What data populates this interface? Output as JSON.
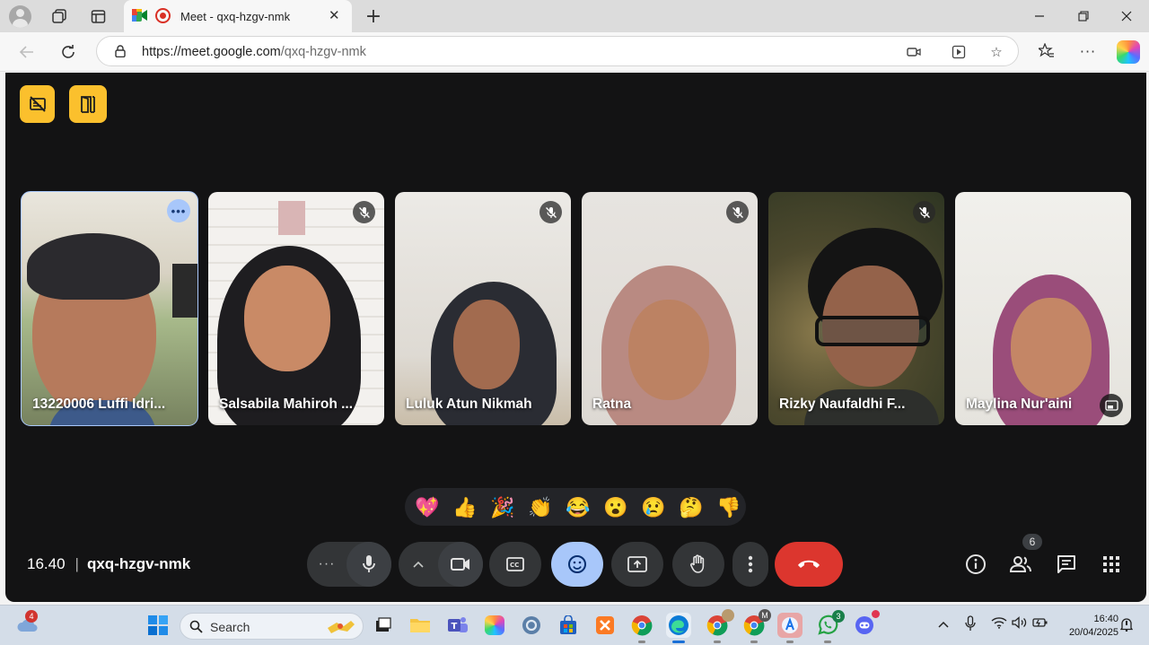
{
  "browser": {
    "tab_title": "Meet - qxq-hzgv-nmk",
    "url_host": "https://meet.google.com",
    "url_path": "/qxq-hzgv-nmk"
  },
  "meeting": {
    "time": "16.40",
    "separator": "|",
    "code": "qxq-hzgv-nmk",
    "participant_count": "6"
  },
  "participants": [
    {
      "name": "13220006 Luffi Idri...",
      "active": true
    },
    {
      "name": "Salsabila Mahiroh ...",
      "muted": true
    },
    {
      "name": "Luluk Atun Nikmah",
      "muted": true
    },
    {
      "name": "Ratna",
      "muted": true
    },
    {
      "name": "Rizky Naufaldhi F...",
      "muted": true
    },
    {
      "name": "Maylina Nur'aini"
    }
  ],
  "reactions": [
    "💖",
    "👍",
    "🎉",
    "👏",
    "😂",
    "😮",
    "😢",
    "🤔",
    "👎"
  ],
  "taskbar": {
    "search_placeholder": "Search",
    "weather_badge": "4",
    "whatsapp_badge": "3",
    "chrome_profile_badge": "M",
    "clock_time": "16:40",
    "clock_date": "20/04/2025"
  },
  "colors": {
    "stage_bg": "#131314",
    "accent": "#a8c7fa",
    "end_call": "#dc362e",
    "corner_buttons": "#fbc02d"
  }
}
